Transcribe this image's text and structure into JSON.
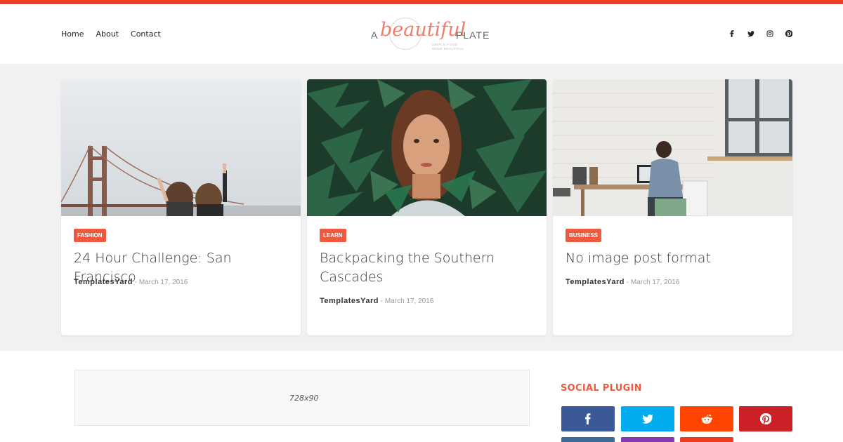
{
  "nav": {
    "items": [
      "Home",
      "About",
      "Contact"
    ]
  },
  "logo": {
    "a": "A",
    "beautiful": "beautiful",
    "plate": "PLATE",
    "tagline1": "SIMPLE FOOD",
    "tagline2": "MADE BEAUTIFUL"
  },
  "social_top": [
    "facebook-icon",
    "twitter-icon",
    "instagram-icon",
    "pinterest-icon"
  ],
  "featured": [
    {
      "label": "FASHION",
      "title": "24 Hour Challenge: San Francisco",
      "author": "TemplatesYard",
      "separator": " - ",
      "date": "March 17, 2016"
    },
    {
      "label": "LEARN",
      "title": "Backpacking the Southern Cascades",
      "author": "TemplatesYard",
      "separator": " - ",
      "date": "March 17, 2016"
    },
    {
      "label": "BUSINESS",
      "title": "No image post format",
      "author": "TemplatesYard",
      "separator": " - ",
      "date": "March 17, 2016"
    }
  ],
  "ad": {
    "text": "728x90"
  },
  "sidebar": {
    "widget_title": "SOCIAL PLUGIN",
    "buttons": [
      {
        "icon": "facebook-icon",
        "color": "#3b5999"
      },
      {
        "icon": "twitter-icon",
        "color": "#00acee"
      },
      {
        "icon": "reddit-icon",
        "color": "#ff4500"
      },
      {
        "icon": "pinterest-icon",
        "color": "#ca2127"
      }
    ],
    "second_row_colors": [
      "#3e6a95",
      "#833ab4",
      "#ef3b20"
    ]
  },
  "colors": {
    "accent": "#f13c20",
    "label_bg": "#ef5a3f",
    "featured_bg": "#f1f1f1"
  }
}
